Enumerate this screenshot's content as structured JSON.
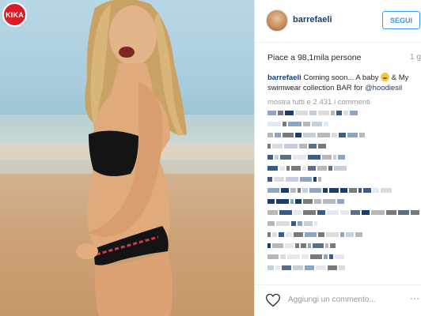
{
  "photo": {
    "badge": "KIKA",
    "description_icon": "photo-icon"
  },
  "post": {
    "username": "barrefaeli",
    "follow_label": "SEGUI",
    "likes": "Piace a 98,1mila persone",
    "time": "1 g",
    "caption": {
      "username": "barrefaeli",
      "text_before_emoji": "Coming soon... A baby",
      "text_after_emoji": "& My swimwear collection BAR for",
      "mention": "@hoodiesil"
    },
    "show_all": "mostra tutti e 2.431 i commenti",
    "add_comment_placeholder": "Aggiungi un commento...",
    "more": "⋯"
  },
  "colors": {
    "follow": "#3897f0",
    "username": "#1a3d6b",
    "muted": "#999999",
    "kika_red": "#d71d25"
  }
}
